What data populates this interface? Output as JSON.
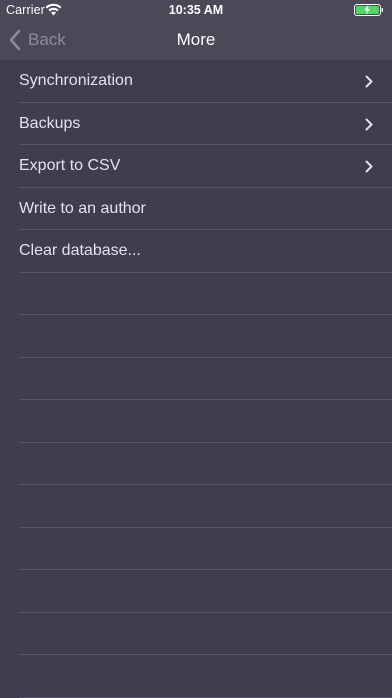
{
  "status_bar": {
    "carrier": "Carrier",
    "time": "10:35 AM",
    "battery_level": 1.0,
    "battery_color": "#4cd964"
  },
  "nav": {
    "back_label": "Back",
    "title": "More"
  },
  "menu": {
    "items": [
      {
        "label": "Synchronization",
        "has_chevron": true
      },
      {
        "label": "Backups",
        "has_chevron": true
      },
      {
        "label": "Export to CSV",
        "has_chevron": true
      },
      {
        "label": "Write to an author",
        "has_chevron": false
      },
      {
        "label": "Clear database...",
        "has_chevron": false
      }
    ]
  },
  "colors": {
    "background": "#403d50",
    "navbar": "#4b4858",
    "separator": "#55526a",
    "text": "#e4e2ea"
  }
}
